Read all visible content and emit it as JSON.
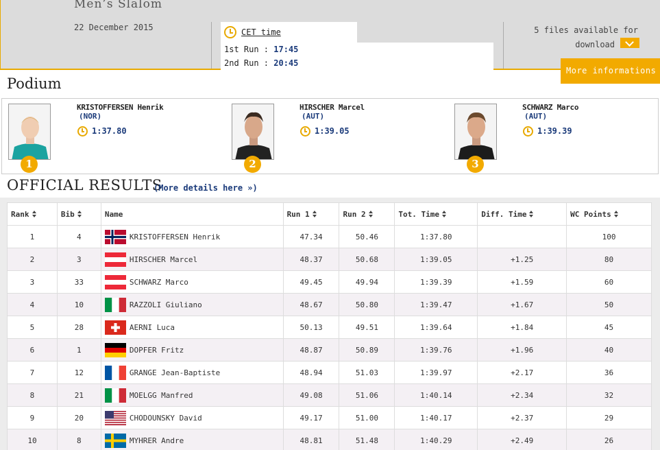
{
  "event": {
    "title": "Men’s Slalom",
    "date": "22 December 2015",
    "cet_label": "CET time",
    "runs": [
      {
        "label": "1st Run :",
        "time": "17:45"
      },
      {
        "label": "2nd Run :",
        "time": "20:45"
      }
    ],
    "files_text": "5 files available for",
    "download_label": "download",
    "more_info": "More informations"
  },
  "podium": {
    "title": "Podium",
    "entries": [
      {
        "place": "1",
        "name": "KRISTOFFERSEN Henrik",
        "nat": "(NOR)",
        "time": "1:37.80"
      },
      {
        "place": "2",
        "name": "HIRSCHER Marcel",
        "nat": "(AUT)",
        "time": "1:39.05"
      },
      {
        "place": "3",
        "name": "SCHWARZ Marco",
        "nat": "(AUT)",
        "time": "1:39.39"
      }
    ]
  },
  "results": {
    "title": "OFFICIAL RESULTS",
    "more_details": "(More details here »)",
    "headers": {
      "rank": "Rank",
      "bib": "Bib",
      "name": "Name",
      "run1": "Run 1",
      "run2": "Run 2",
      "tot": "Tot. Time",
      "diff": "Diff. Time",
      "wc": "WC Points"
    },
    "rows": [
      {
        "rank": "1",
        "bib": "4",
        "flag": "NOR",
        "name": "KRISTOFFERSEN Henrik",
        "run1": "47.34",
        "run2": "50.46",
        "tot": "1:37.80",
        "diff": "",
        "wc": "100"
      },
      {
        "rank": "2",
        "bib": "3",
        "flag": "AUT",
        "name": "HIRSCHER Marcel",
        "run1": "48.37",
        "run2": "50.68",
        "tot": "1:39.05",
        "diff": "+1.25",
        "wc": "80"
      },
      {
        "rank": "3",
        "bib": "33",
        "flag": "AUT",
        "name": "SCHWARZ Marco",
        "run1": "49.45",
        "run2": "49.94",
        "tot": "1:39.39",
        "diff": "+1.59",
        "wc": "60"
      },
      {
        "rank": "4",
        "bib": "10",
        "flag": "ITA",
        "name": "RAZZOLI Giuliano",
        "run1": "48.67",
        "run2": "50.80",
        "tot": "1:39.47",
        "diff": "+1.67",
        "wc": "50"
      },
      {
        "rank": "5",
        "bib": "28",
        "flag": "SUI",
        "name": "AERNI Luca",
        "run1": "50.13",
        "run2": "49.51",
        "tot": "1:39.64",
        "diff": "+1.84",
        "wc": "45"
      },
      {
        "rank": "6",
        "bib": "1",
        "flag": "GER",
        "name": "DOPFER Fritz",
        "run1": "48.87",
        "run2": "50.89",
        "tot": "1:39.76",
        "diff": "+1.96",
        "wc": "40"
      },
      {
        "rank": "7",
        "bib": "12",
        "flag": "FRA",
        "name": "GRANGE Jean-Baptiste",
        "run1": "48.94",
        "run2": "51.03",
        "tot": "1:39.97",
        "diff": "+2.17",
        "wc": "36"
      },
      {
        "rank": "8",
        "bib": "21",
        "flag": "ITA",
        "name": "MOELGG Manfred",
        "run1": "49.08",
        "run2": "51.06",
        "tot": "1:40.14",
        "diff": "+2.34",
        "wc": "32"
      },
      {
        "rank": "9",
        "bib": "20",
        "flag": "USA",
        "name": "CHODOUNSKY David",
        "run1": "49.17",
        "run2": "51.00",
        "tot": "1:40.17",
        "diff": "+2.37",
        "wc": "29"
      },
      {
        "rank": "10",
        "bib": "8",
        "flag": "SWE",
        "name": "MYHRER Andre",
        "run1": "48.81",
        "run2": "51.48",
        "tot": "1:40.29",
        "diff": "+2.49",
        "wc": "26"
      }
    ]
  }
}
